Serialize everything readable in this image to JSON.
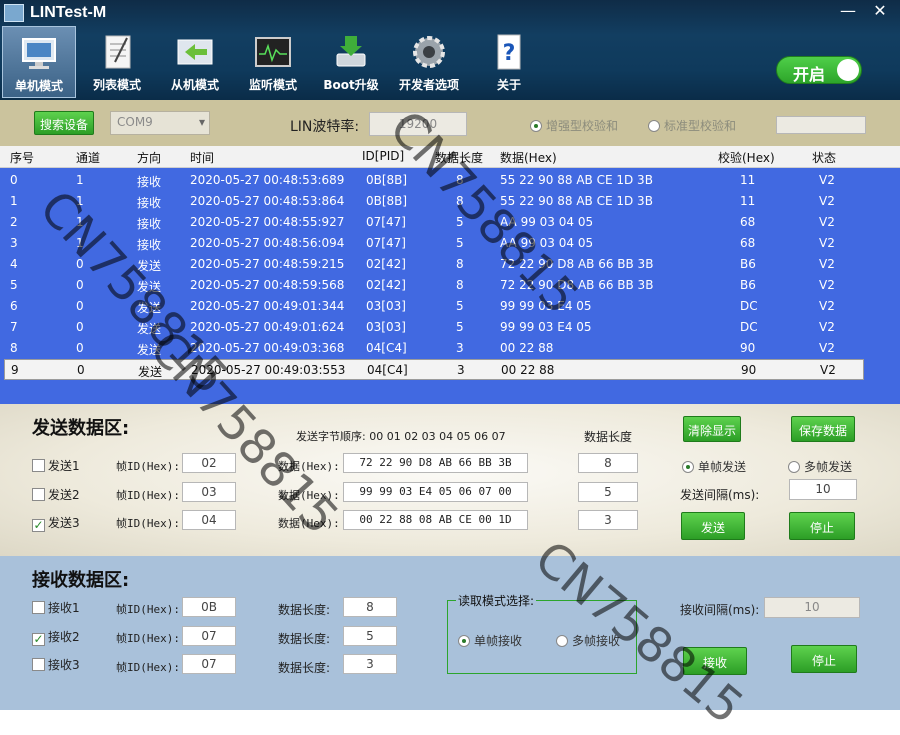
{
  "app": {
    "title": "LINTest-M"
  },
  "window_controls": {
    "minimize": "—",
    "close": "✕"
  },
  "toolbar": [
    {
      "label": "单机模式",
      "icon": "monitor-icon",
      "active": true
    },
    {
      "label": "列表模式",
      "icon": "notepad-icon",
      "active": false
    },
    {
      "label": "从机模式",
      "icon": "arrow-panel-icon",
      "active": false
    },
    {
      "label": "监听模式",
      "icon": "oscilloscope-icon",
      "active": false
    },
    {
      "label": "Boot升级",
      "icon": "download-disk-icon",
      "active": false
    },
    {
      "label": "开发者选项",
      "icon": "gear-icon",
      "active": false
    },
    {
      "label": "关于",
      "icon": "help-icon",
      "active": false
    }
  ],
  "power_toggle": {
    "label": "开启",
    "on": true
  },
  "settings": {
    "search_button": "搜索设备",
    "com_port": "COM9",
    "baud_label": "LIN波特率:",
    "baud_value": "19200",
    "checksum_enhanced": "增强型校验和",
    "checksum_standard": "标准型校验和"
  },
  "table": {
    "columns": [
      "序号",
      "通道",
      "方向",
      "时间",
      "ID[PID]",
      "数据长度",
      "数据(Hex)",
      "校验(Hex)",
      "状态"
    ],
    "rows": [
      [
        "0",
        "1",
        "接收",
        "2020-05-27 00:48:53:689",
        "0B[8B]",
        "8",
        "55 22 90 88 AB CE 1D 3B",
        "11",
        "V2"
      ],
      [
        "1",
        "1",
        "接收",
        "2020-05-27 00:48:53:864",
        "0B[8B]",
        "8",
        "55 22 90 88 AB CE 1D 3B",
        "11",
        "V2"
      ],
      [
        "2",
        "1",
        "接收",
        "2020-05-27 00:48:55:927",
        "07[47]",
        "5",
        "AA 99 03 04 05",
        "68",
        "V2"
      ],
      [
        "3",
        "1",
        "接收",
        "2020-05-27 00:48:56:094",
        "07[47]",
        "5",
        "AA 99 03 04 05",
        "68",
        "V2"
      ],
      [
        "4",
        "0",
        "发送",
        "2020-05-27 00:48:59:215",
        "02[42]",
        "8",
        "72 22 90 D8 AB 66 BB 3B",
        "B6",
        "V2"
      ],
      [
        "5",
        "0",
        "发送",
        "2020-05-27 00:48:59:568",
        "02[42]",
        "8",
        "72 22 90 D8 AB 66 BB 3B",
        "B6",
        "V2"
      ],
      [
        "6",
        "0",
        "发送",
        "2020-05-27 00:49:01:344",
        "03[03]",
        "5",
        "99 99 03 E4 05",
        "DC",
        "V2"
      ],
      [
        "7",
        "0",
        "发送",
        "2020-05-27 00:49:01:624",
        "03[03]",
        "5",
        "99 99 03 E4 05",
        "DC",
        "V2"
      ],
      [
        "8",
        "0",
        "发送",
        "2020-05-27 00:49:03:368",
        "04[C4]",
        "3",
        "00 22 88",
        "90",
        "V2"
      ],
      [
        "9",
        "0",
        "发送",
        "2020-05-27 00:49:03:553",
        "04[C4]",
        "3",
        "00 22 88",
        "90",
        "V2"
      ]
    ],
    "selected_row": 9
  },
  "send": {
    "title": "发送数据区:",
    "byte_order_label": "发送字节顺序: 00 01 02 03 04 05 06 07",
    "length_header": "数据长度",
    "frame_id_label": "帧ID(Hex):",
    "data_label": "数据(Hex):",
    "rows": [
      {
        "check_label": "发送1",
        "checked": false,
        "frame_id": "02",
        "data": "72 22 90 D8 AB 66 BB 3B",
        "length": "8"
      },
      {
        "check_label": "发送2",
        "checked": false,
        "frame_id": "03",
        "data": "99 99 03 E4 05 06 07 00",
        "length": "5"
      },
      {
        "check_label": "发送3",
        "checked": true,
        "frame_id": "04",
        "data": "00 22 88 08 AB CE 00 1D",
        "length": "3"
      }
    ],
    "clear_button": "清除显示",
    "save_button": "保存数据",
    "single_label": "单帧发送",
    "multi_label": "多帧发送",
    "interval_label": "发送间隔(ms):",
    "interval_value": "10",
    "send_button": "发送",
    "stop_button": "停止"
  },
  "recv": {
    "title": "接收数据区:",
    "frame_id_label": "帧ID(Hex):",
    "length_label": "数据长度:",
    "rows": [
      {
        "check_label": "接收1",
        "checked": false,
        "frame_id": "0B",
        "length": "8"
      },
      {
        "check_label": "接收2",
        "checked": true,
        "frame_id": "07",
        "length": "5"
      },
      {
        "check_label": "接收3",
        "checked": false,
        "frame_id": "07",
        "length": "3"
      }
    ],
    "mode_title": "读取模式选择:",
    "single_label": "单帧接收",
    "multi_label": "多帧接收",
    "interval_label": "接收间隔(ms):",
    "interval_value": "10",
    "recv_button": "接收",
    "stop_button": "停止"
  },
  "watermark": "CN758815"
}
